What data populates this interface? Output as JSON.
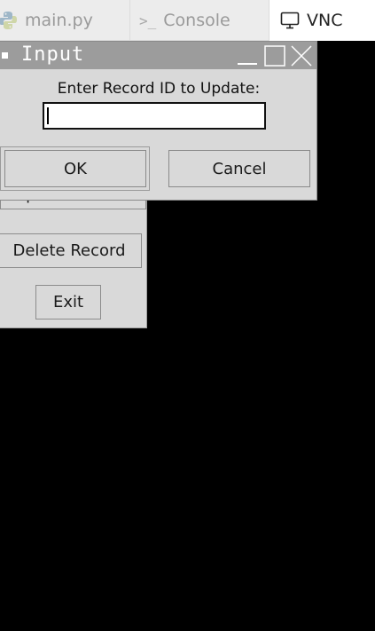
{
  "tabs": [
    {
      "label": "main.py",
      "icon": "python-icon",
      "active": false
    },
    {
      "label": "Console",
      "icon": "terminal-icon",
      "active": false
    },
    {
      "label": "VNC",
      "icon": "monitor-icon",
      "active": true
    }
  ],
  "dialog": {
    "title": "Input",
    "prompt": "Enter Record ID to Update:",
    "entry_value": "",
    "ok_label": "OK",
    "cancel_label": "Cancel"
  },
  "app_window": {
    "update_label": "Update Record",
    "delete_label": "Delete Record",
    "exit_label": "Exit"
  },
  "colors": {
    "desktop": "#000000",
    "dialog_bg": "#d9d9d9",
    "titlebar": "#9c9c9c",
    "tabbar": "#ececec"
  }
}
